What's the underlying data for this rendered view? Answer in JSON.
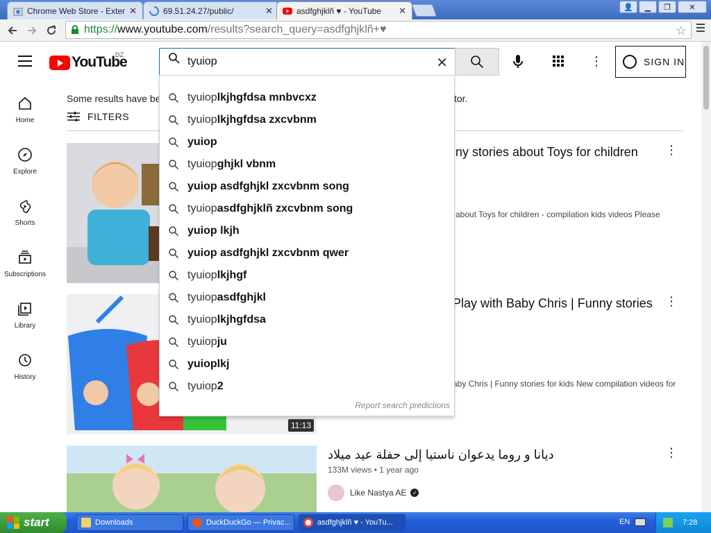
{
  "browser": {
    "tabs": [
      {
        "title": "Chrome Web Store - Extensi",
        "active": false
      },
      {
        "title": "69.51.24.27/public/",
        "active": false
      },
      {
        "title": "asdfghjklñ ♥ - YouTube",
        "active": true
      }
    ],
    "url_scheme": "https://",
    "url_host": "www.youtube.com",
    "url_rest": "/results?search_query=asdfghjklñ+♥"
  },
  "youtube": {
    "country_code": "DZ",
    "logo_text": "YouTube",
    "search_query": "tyuiop",
    "signin_label": "SIGN IN",
    "notice": "Some results have been removed because Restricted Mode is enabled by your administrator.",
    "filters_label": "FILTERS"
  },
  "guide": [
    {
      "label": "Home",
      "icon": "home-icon"
    },
    {
      "label": "Explore",
      "icon": "compass-icon"
    },
    {
      "label": "Shorts",
      "icon": "shorts-icon"
    },
    {
      "label": "Subscriptions",
      "icon": "subscriptions-icon"
    },
    {
      "label": "Library",
      "icon": "library-icon"
    },
    {
      "label": "History",
      "icon": "history-icon"
    }
  ],
  "suggestions": [
    {
      "typed": "tyuiop",
      "rest": " lkjhgfdsa mnbvcxz"
    },
    {
      "typed": "tyuiop",
      "rest": " lkjhgfdsa zxcvbnm"
    },
    {
      "typed": "",
      "rest": "yuiop"
    },
    {
      "typed": "tyuiop",
      "rest": " ghjkl vbnm"
    },
    {
      "typed": "",
      "rest": "yuiop asdfghjkl zxcvbnm song"
    },
    {
      "typed": "tyuiop",
      "rest": " asdfghjklñ zxcvbnm song"
    },
    {
      "typed": "",
      "rest": "yuiop lkjh"
    },
    {
      "typed": "",
      "rest": "yuiop asdfghjkl zxcvbnm qwer"
    },
    {
      "typed": "tyuiop",
      "rest": " lkjhgf"
    },
    {
      "typed": "tyuiop",
      "rest": " asdfghjkl"
    },
    {
      "typed": "tyuiop",
      "rest": " lkjhgfdsa"
    },
    {
      "typed": "tyuiop",
      "rest": " ju"
    },
    {
      "typed": "",
      "rest": "yuioplkj"
    },
    {
      "typed": "tyuiop",
      "rest": " 2"
    }
  ],
  "report_label": "Report search predictions",
  "videos": [
    {
      "title_visible": "ny stories about Toys for children",
      "desc_visible": "about Toys for children - compilation kids videos Please",
      "duration": ""
    },
    {
      "title_visible": "Play with Baby Chris | Funny stories",
      "desc_visible": "aby Chris | Funny stories for kids New compilation videos for",
      "duration": "11:13"
    },
    {
      "title": "ديانا و روما يدعوان ناستيا إلى حفلة عيد ميلاد",
      "meta": "133M views • 1 year ago",
      "channel": "Like Nastya AE"
    }
  ],
  "taskbar": {
    "start_label": "start",
    "tasks": [
      {
        "label": "Downloads",
        "active": false
      },
      {
        "label": "DuckDuckGo — Privac...",
        "active": false
      },
      {
        "label": "asdfghjklñ ♥ - YouTu...",
        "active": true
      }
    ],
    "language": "EN",
    "clock": "7:28"
  }
}
